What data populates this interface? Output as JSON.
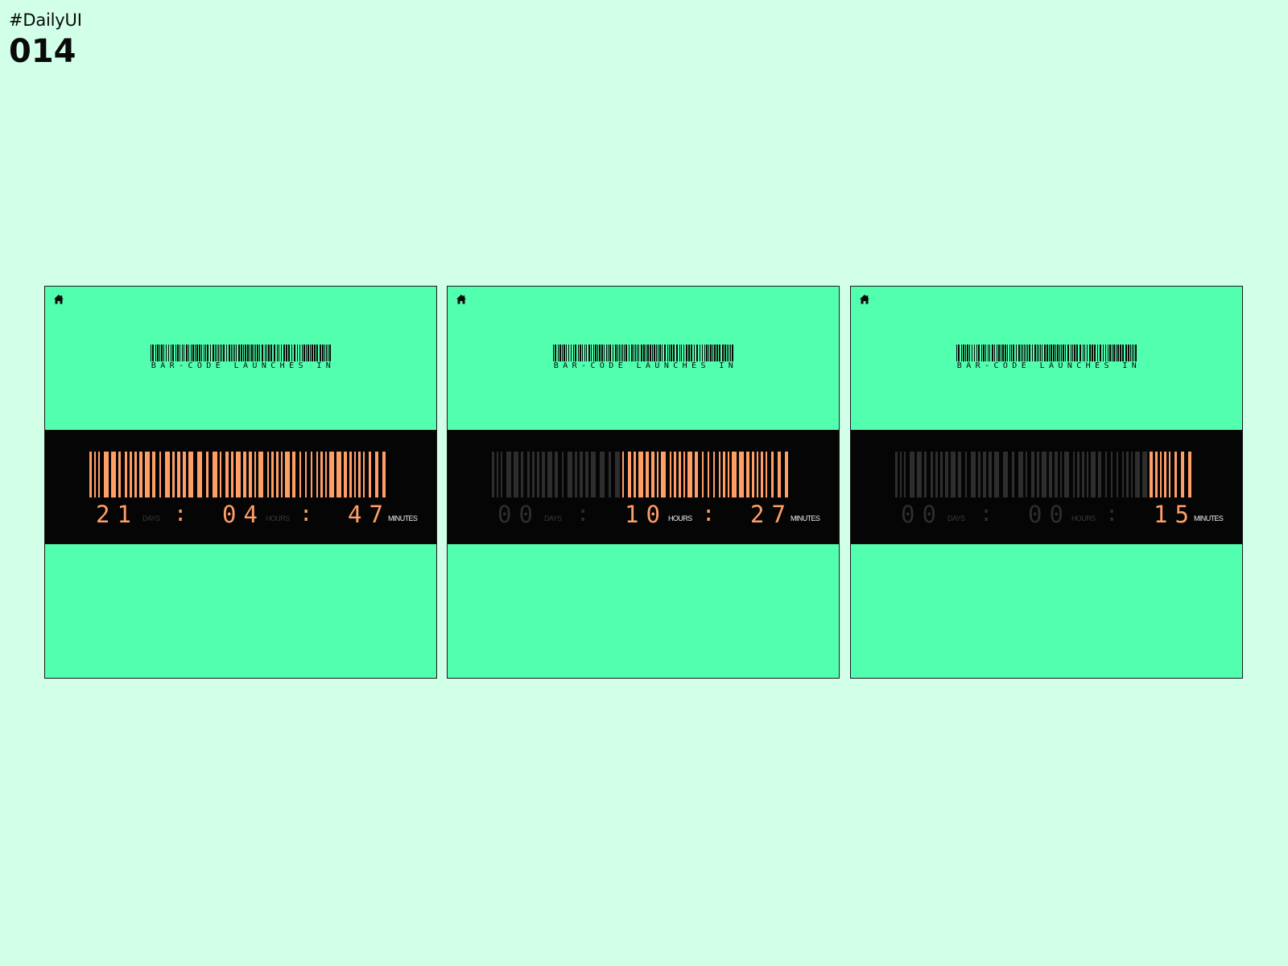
{
  "header": {
    "tag": "#DailyUI",
    "number": "014"
  },
  "colors": {
    "page_bg": "#d1ffe8",
    "card_bg": "#52ffae",
    "band_bg": "#050505",
    "accent": "#ff9f66",
    "dim": "#2e2e2e"
  },
  "cards": [
    {
      "home_icon": "home-icon",
      "label": "BAR-CODE LAUNCHES IN",
      "days": "21",
      "days_unit": "DAYS",
      "hours": "04",
      "hours_unit": "HOURS",
      "minutes": "47",
      "minutes_unit": "MINUTES",
      "separator": ":",
      "active_from": 0
    },
    {
      "home_icon": "home-icon",
      "label": "BAR-CODE LAUNCHES IN",
      "days": "00",
      "days_unit": "DAYS",
      "hours": "10",
      "hours_unit": "HOURS",
      "minutes": "27",
      "minutes_unit": "MINUTES",
      "separator": ":",
      "active_from": 1
    },
    {
      "home_icon": "home-icon",
      "label": "BAR-CODE LAUNCHES IN",
      "days": "00",
      "days_unit": "DAYS",
      "hours": "00",
      "hours_unit": "HOURS",
      "minutes": "15",
      "minutes_unit": "MINUTES",
      "separator": ":",
      "active_from": 2
    }
  ]
}
